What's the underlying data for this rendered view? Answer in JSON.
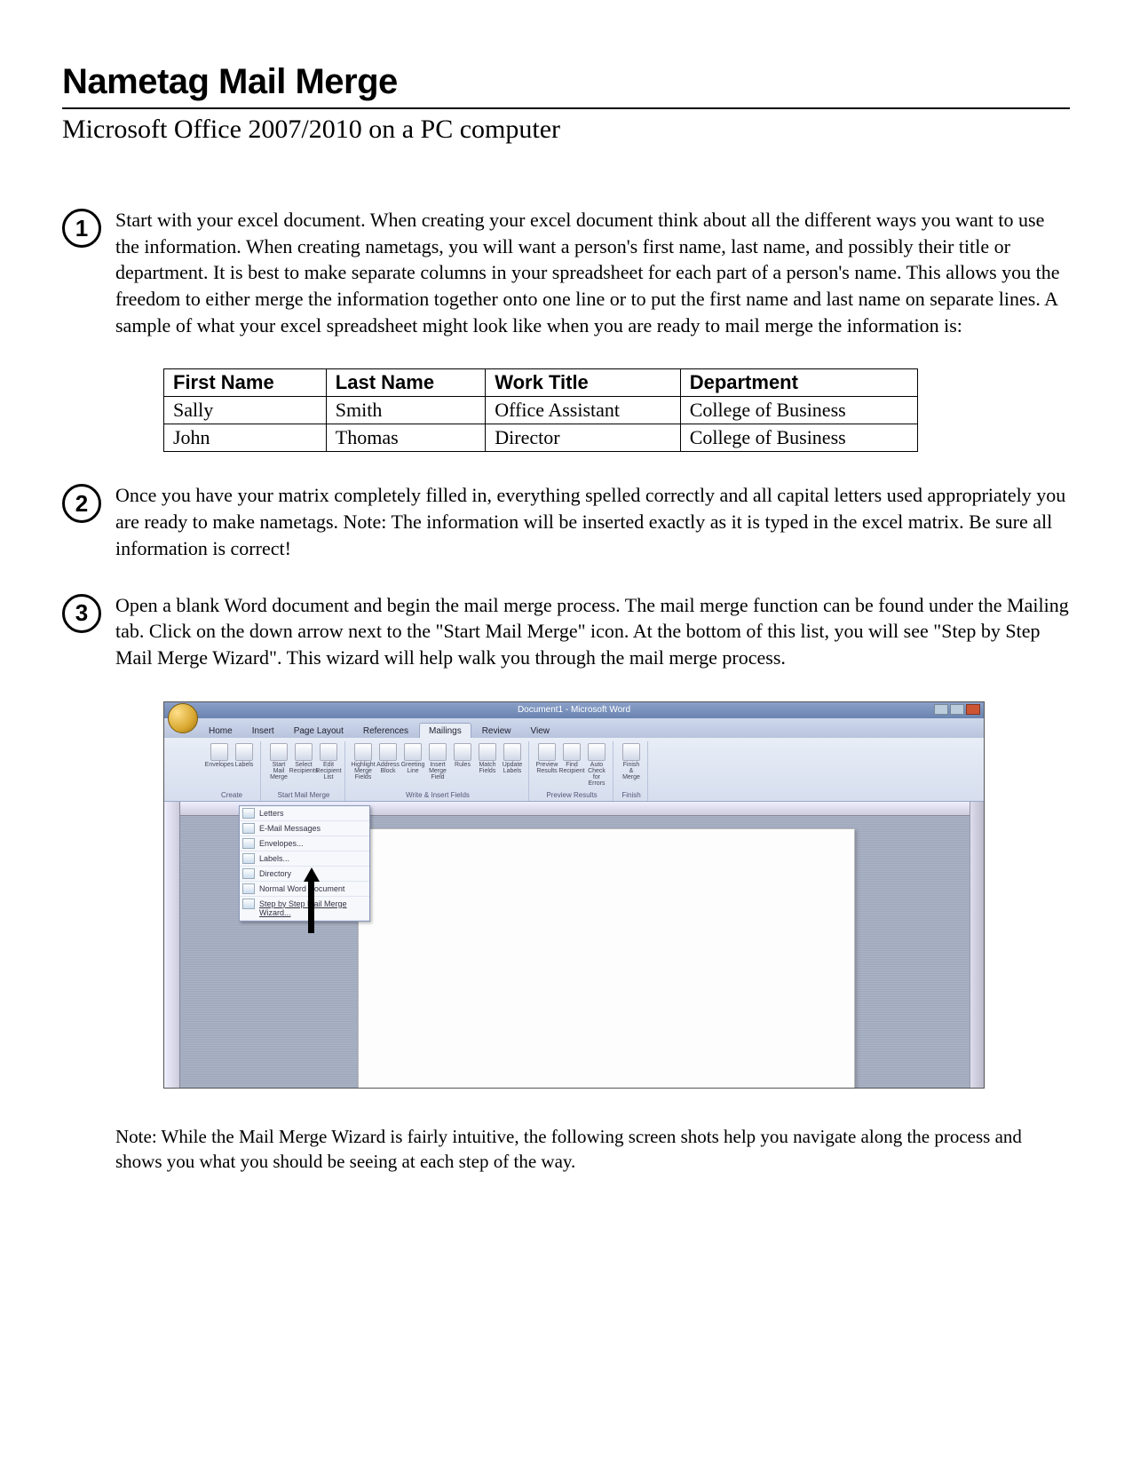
{
  "header": {
    "title": "Nametag Mail Merge",
    "subtitle": "Microsoft Office 2007/2010 on a PC computer"
  },
  "steps": [
    {
      "num": "1",
      "text": "Start with your excel document. When creating your excel document think about all the different ways you want to use the information. When creating nametags, you will want a person's first name, last name, and possibly their title or department. It is best to make separate columns in your spreadsheet for each part of a person's name. This allows you the freedom to either merge the information together onto one line or to put the first name and last name on separate lines. A sample of what your excel spreadsheet might look like when you are ready to mail merge the information is:"
    },
    {
      "num": "2",
      "text": "Once you have your matrix completely filled in, everything spelled correctly and all capital letters used appropriately you are ready to make nametags. Note: The information will be inserted exactly as it is typed in the excel matrix. Be sure all information is correct!"
    },
    {
      "num": "3",
      "text": "Open a blank Word document and begin the mail merge process. The mail merge function can be found under the Mailing tab. Click on the down arrow next to the \"Start Mail Merge\" icon. At the bottom of this list, you will see \"Step by Step Mail Merge Wizard\". This wizard will help walk you through the mail merge process."
    }
  ],
  "table": {
    "headers": [
      "First Name",
      "Last Name",
      "Work Title",
      "Department"
    ],
    "rows": [
      [
        "Sally",
        "Smith",
        "Office Assistant",
        "College of Business"
      ],
      [
        "John",
        "Thomas",
        "Director",
        "College of Business"
      ]
    ]
  },
  "word": {
    "title": "Document1 - Microsoft Word",
    "tabs": [
      "Home",
      "Insert",
      "Page Layout",
      "References",
      "Mailings",
      "Review",
      "View"
    ],
    "active_tab": "Mailings",
    "ribbon_groups": [
      {
        "label": "Create",
        "icons": [
          "Envelopes",
          "Labels"
        ]
      },
      {
        "label": "Start Mail Merge",
        "icons": [
          "Start Mail Merge",
          "Select Recipients",
          "Edit Recipient List"
        ]
      },
      {
        "label": "Write & Insert Fields",
        "icons": [
          "Highlight Merge Fields",
          "Address Block",
          "Greeting Line",
          "Insert Merge Field",
          "Rules",
          "Match Fields",
          "Update Labels"
        ]
      },
      {
        "label": "Preview Results",
        "icons": [
          "Preview Results",
          "Find Recipient",
          "Auto Check for Errors"
        ]
      },
      {
        "label": "Finish",
        "icons": [
          "Finish & Merge"
        ]
      }
    ],
    "dropdown": [
      "Letters",
      "E-Mail Messages",
      "Envelopes...",
      "Labels...",
      "Directory",
      "Normal Word Document",
      "Step by Step Mail Merge Wizard..."
    ]
  },
  "note": "Note: While the Mail Merge Wizard is fairly intuitive, the following screen shots help you navigate along the process and shows you what you should be seeing at each step of the way."
}
